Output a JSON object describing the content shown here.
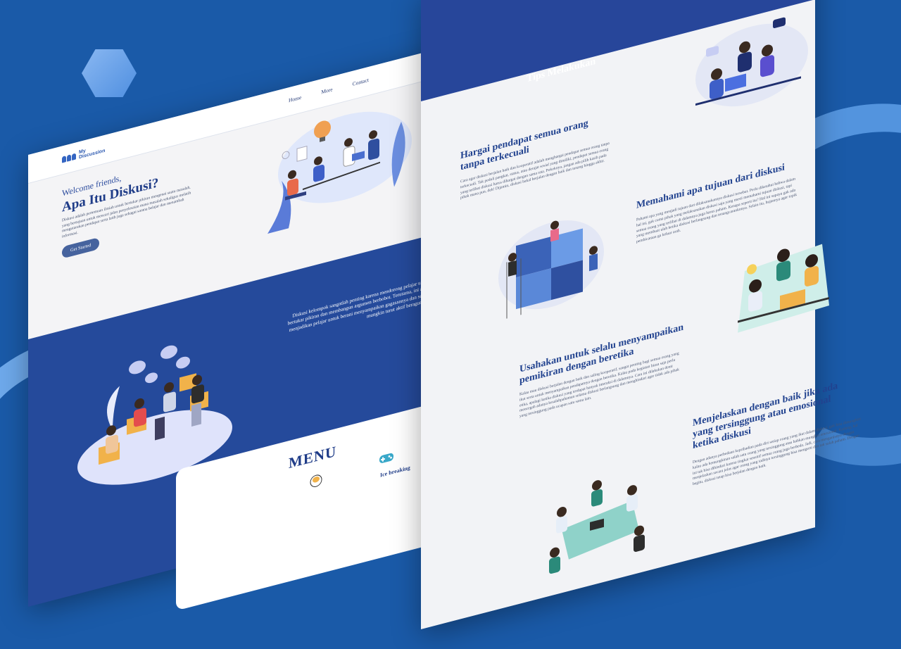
{
  "left": {
    "logo": {
      "line1": "My",
      "line2": "Discussion"
    },
    "nav": [
      "Home",
      "More",
      "Contact"
    ],
    "hero": {
      "welcome": "Welcome friends,",
      "title": "Apa Itu Diskusi?",
      "description": "Diskusi adalah pertemuan ilmiah untuk bertukar pikiran mengenai suatu masalah, yang bertujuan untuk mencari jalan penyelesaian mana masalah sekaligus melatih mengutarakan pendapat serta latih juga sebagai sarana belajar dan menambah informasi.",
      "button": "Get Started"
    },
    "band_text": "Diskusi kelompok sangatlah penting karena mendorong pelajar untuk bertukar pikiran dan membangun argumen berbobot. Terutama, ini akan menjadikan pelajar untuk berani menyampaikan gagasannya dan selalu mungkin turut aktif beragumen.",
    "menu": {
      "title": "MENU",
      "item": "Ice breaking"
    }
  },
  "right": {
    "header_title": "Tips Melakukan",
    "tips": [
      {
        "title": "Hargai pendapat semua orang tanpa terkecuali",
        "text": "Cara agar diskusi berjalan baik dan kooperatif adalah menghargai pendapat semua orang tanpa terkecuali. Tak peduli pangkat, status, atau derajat sosial yang dimiliki, pendapat semua orang yang terlibat diskusi harus dihargai dengan sama rata. Pokoknya, jangan ada pilih kasih pada pihak mana pun, deh! Dijamin, diskusi bakal berjalan dengan baik dan tenang hingga akhir."
      },
      {
        "title": "Memahami apa tujuan dari diskusi",
        "text": "Pahami apa yang menjadi tujuan dari dilaksanakannya diskusi tersebut. Perlu diketahui bahwa dalam hal ini, gak cuma pihak yang melaksanakan diskusi saja yang mesti memahami tujuan diskusi, tapi semua orang yang terlibat di dalamnya juga harus paham. Kenapa seperti itu? Hal ini supaya gak ada yang membuat ulah ketika diskusi berlangsung dan tenangcaranknnya. Selain itu, hujannya agar topik pembicaraan ga keluar arah."
      },
      {
        "title": "Usahakan untuk selalu menyampaikan pemikiran dengan beretika",
        "text": "Kalau mau diskusi berjalan dengan baik dan saling kooperatif, sangat penting bagi semua orang yang ikut serta untuk menyampaikan pendapatnya dengan beretika. Kalau pada kegiatan biasa saja perlu etika, apalagi ketika diskusi yang terdapat banyak interaksi di dalamnya. Cara ini dilakukan demi mencegah adanya kesalahpahaman selama diskusi berlangsung dan menghindari agar tidak ada pihak yang tersinggung pada ucapan satu sama lain."
      },
      {
        "title": "Menjelaskan dengan baik jika ada yang tersinggung atau emosional ketika diskusi",
        "text": "Dengan adanya perbedaan kepribadian pada diri setiap orang yang ikut dalam diskusi, gak bisa dimungkiri kalau ada kemungkinan salah satu orang yang tersinggung atau bahkan mungkin emosional. Kadang, hal ini tak bisa dihindari karena tingkat sensitif semua orang juga berbeda. Jadi, cara menganisnya dengan menjelaskan secara jelas agar orang yang tadinya tersinggung bisa mengerti dan tak salah paham. Dengan begitu, diskusi tetap bisa berjalan dengan baik."
      }
    ]
  }
}
